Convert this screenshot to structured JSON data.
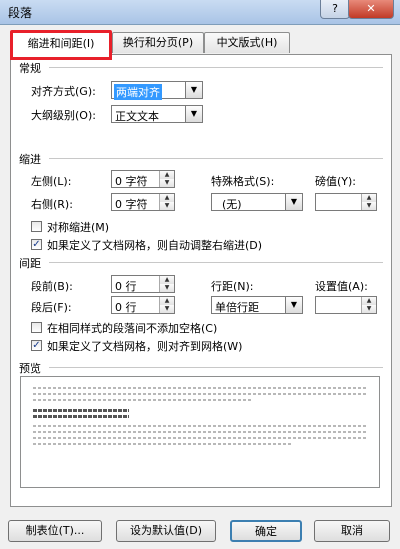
{
  "window": {
    "title": "段落",
    "help_label": "?",
    "close_label": "✕"
  },
  "tabs": [
    {
      "label": "缩进和间距(I)"
    },
    {
      "label": "换行和分页(P)"
    },
    {
      "label": "中文版式(H)"
    }
  ],
  "general": {
    "section": "常规",
    "alignment_label": "对齐方式(G):",
    "alignment_value": "两端对齐",
    "outline_label": "大纲级别(O):",
    "outline_value": "正文文本"
  },
  "indent": {
    "section": "缩进",
    "left_label": "左侧(L):",
    "left_value": "0 字符",
    "right_label": "右侧(R):",
    "right_value": "0 字符",
    "special_label": "特殊格式(S):",
    "special_value": "(无)",
    "by_label": "磅值(Y):",
    "by_value": "",
    "mirror_label": "对称缩进(M)",
    "auto_adjust_label": "如果定义了文档网格，则自动调整右缩进(D)"
  },
  "spacing": {
    "section": "间距",
    "before_label": "段前(B):",
    "before_value": "0 行",
    "after_label": "段后(F):",
    "after_value": "0 行",
    "line_label": "行距(N):",
    "line_value": "单倍行距",
    "at_label": "设置值(A):",
    "at_value": "",
    "no_space_label": "在相同样式的段落间不添加空格(C)",
    "snap_grid_label": "如果定义了文档网格，则对齐到网格(W)"
  },
  "preview": {
    "section": "预览"
  },
  "buttons": {
    "tabs": "制表位(T)...",
    "default": "设为默认值(D)",
    "ok": "确定",
    "cancel": "取消"
  },
  "checks": {
    "mirror": false,
    "auto_adjust": true,
    "no_space": false,
    "snap_grid": true
  },
  "colors": {
    "highlight": "#e8202a",
    "selection": "#3399ff"
  }
}
